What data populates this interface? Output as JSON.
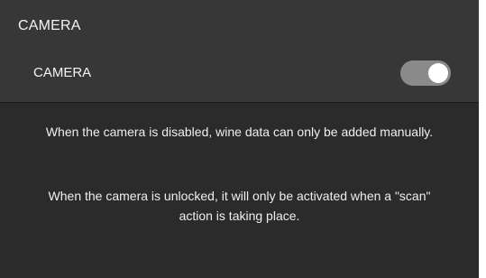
{
  "camera_section": {
    "title": "CAMERA",
    "setting_label": "CAMERA",
    "toggle_state": "on",
    "info_disabled": "When the camera is disabled, wine data can only be added manually.",
    "info_unlocked": "When the camera is unlocked, it will only be activated when a \"scan\" action is taking place."
  },
  "colors": {
    "background": "#2b2b2b",
    "header_background": "#373737",
    "toggle_track": "#8a8a8a",
    "toggle_knob": "#ffffff",
    "text": "#f2f2f2"
  }
}
